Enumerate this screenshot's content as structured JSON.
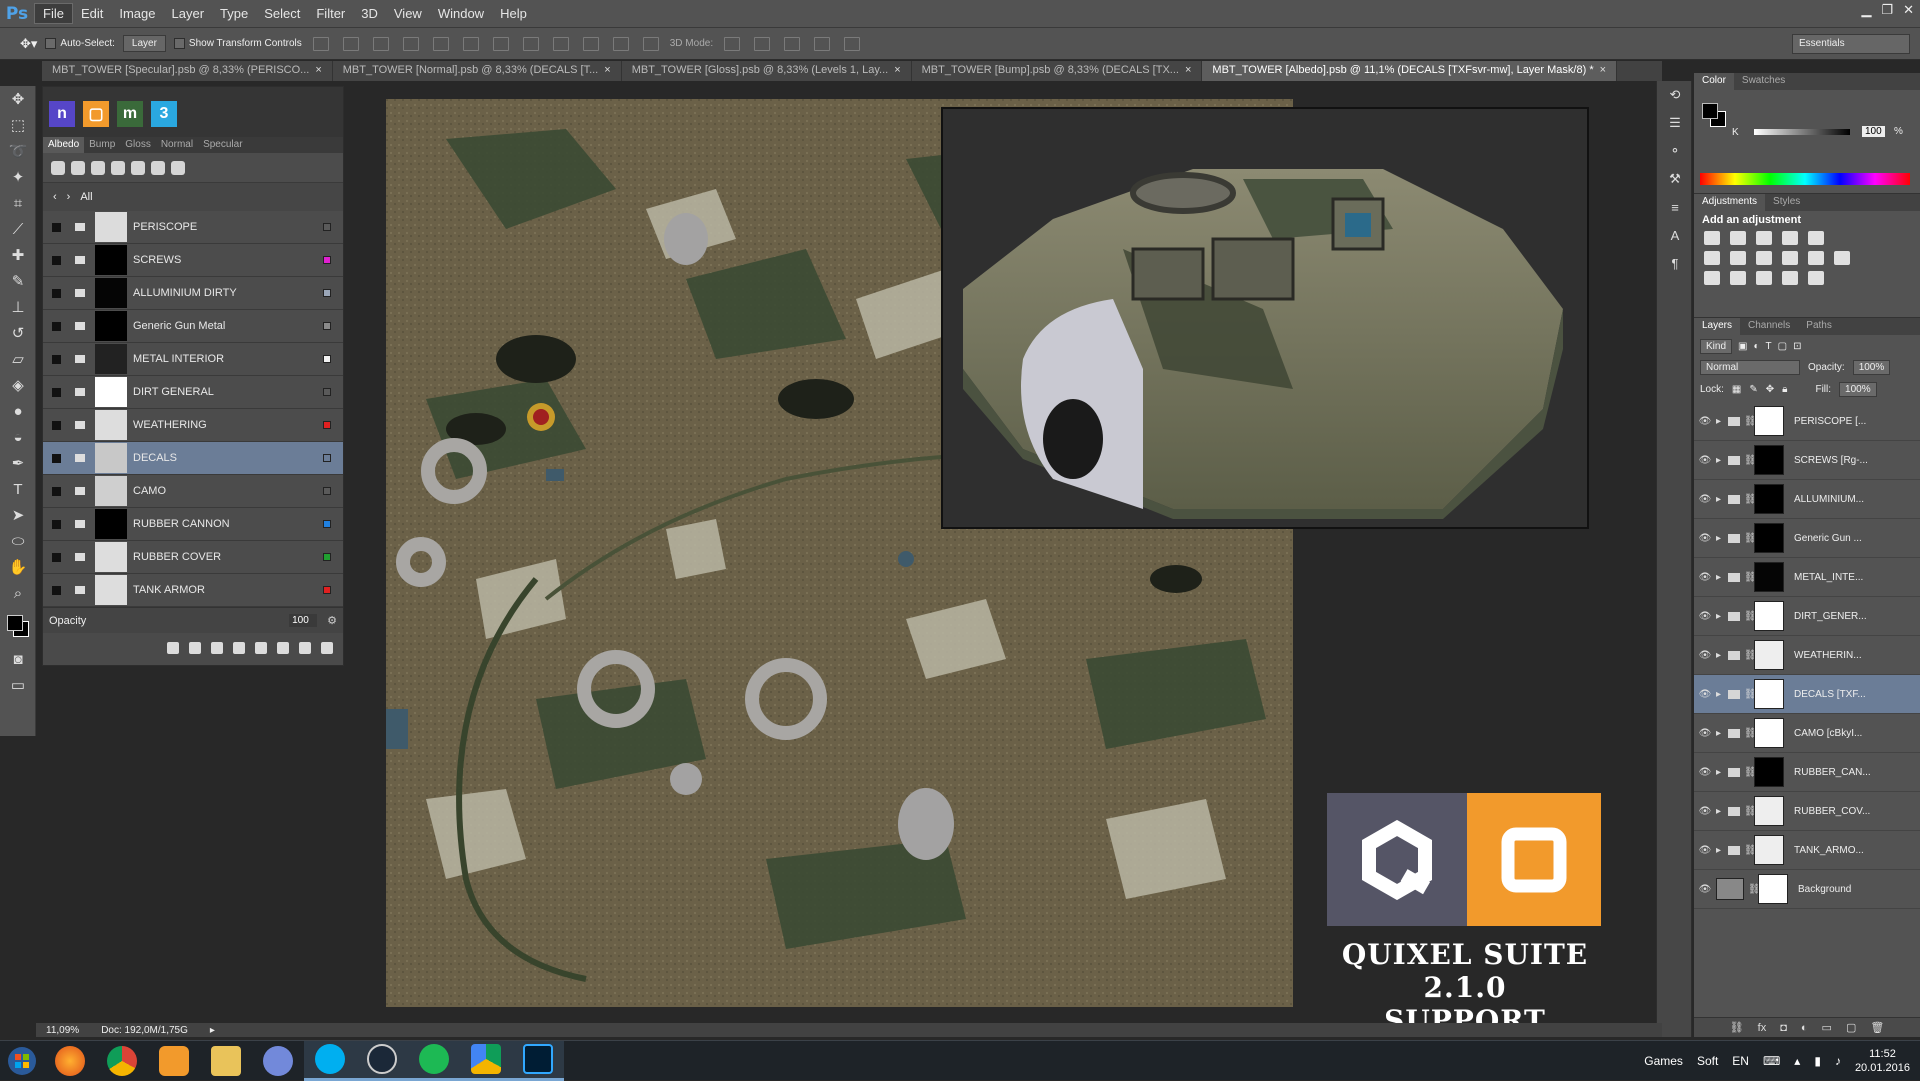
{
  "app": {
    "logo": "Ps"
  },
  "menu": [
    "File",
    "Edit",
    "Image",
    "Layer",
    "Type",
    "Select",
    "Filter",
    "3D",
    "View",
    "Window",
    "Help"
  ],
  "options": {
    "auto_select": "Auto-Select:",
    "layer_select": "Layer",
    "show_transform": "Show Transform Controls",
    "mode_3d": "3D Mode:",
    "workspace": "Essentials"
  },
  "tabs": [
    {
      "label": "MBT_TOWER [Specular].psb @ 8,33% (PERISCO...",
      "active": false
    },
    {
      "label": "MBT_TOWER [Normal].psb @ 8,33% (DECALS [T...",
      "active": false
    },
    {
      "label": "MBT_TOWER [Gloss].psb @ 8,33% (Levels 1, Lay...",
      "active": false
    },
    {
      "label": "MBT_TOWER [Bump].psb @ 8,33% (DECALS [TX...",
      "active": false
    },
    {
      "label": "MBT_TOWER [Albedo].psb @ 11,1% (DECALS [TXFsvr-mw], Layer Mask/8) *",
      "active": true
    }
  ],
  "ddo": {
    "tabs": [
      "Albedo",
      "Bump",
      "Gloss",
      "Normal",
      "Specular"
    ],
    "filter": "All",
    "layers": [
      {
        "name": "PERISCOPE",
        "thumb": "#dcdcdc",
        "swatch": "#5a5a5a",
        "selected": false
      },
      {
        "name": "SCREWS",
        "thumb": "#000000",
        "swatch": "#e020d0",
        "selected": false
      },
      {
        "name": "ALLUMINIUM DIRTY",
        "thumb": "#050505",
        "swatch": "#9aa6b8",
        "selected": false
      },
      {
        "name": "Generic Gun Metal",
        "thumb": "#000000",
        "swatch": "#8a8a8a",
        "selected": false
      },
      {
        "name": "METAL INTERIOR",
        "thumb": "#222222",
        "swatch": "#f2f2f2",
        "selected": false
      },
      {
        "name": "DIRT GENERAL",
        "thumb": "#ffffff",
        "swatch": "#5a5a5a",
        "selected": false
      },
      {
        "name": "WEATHERING",
        "thumb": "#dddddd",
        "swatch": "#e02020",
        "selected": false
      },
      {
        "name": "DECALS",
        "thumb": "#c8c8c8",
        "swatch": "#6b7d97",
        "selected": true
      },
      {
        "name": "CAMO",
        "thumb": "#cfcfcf",
        "swatch": "#5a5a5a",
        "selected": false
      },
      {
        "name": "RUBBER CANNON",
        "thumb": "#000000",
        "swatch": "#2080e0",
        "selected": false
      },
      {
        "name": "RUBBER COVER",
        "thumb": "#dddddd",
        "swatch": "#20a030",
        "selected": false
      },
      {
        "name": "TANK ARMOR",
        "thumb": "#dddddd",
        "swatch": "#e02020",
        "selected": false
      }
    ],
    "opacity_label": "Opacity",
    "opacity_value": "100"
  },
  "overlay_text": {
    "line1": "QUIXEL SUITE 2.1.0",
    "line2": "SUPPORT"
  },
  "color_panel": {
    "tabs": [
      "Color",
      "Swatches"
    ],
    "channel": "K",
    "value": "100",
    "unit": "%"
  },
  "adjustments": {
    "tabs": [
      "Adjustments",
      "Styles"
    ],
    "title": "Add an adjustment"
  },
  "layers_panel": {
    "tabs": [
      "Layers",
      "Channels",
      "Paths"
    ],
    "kind": "Kind",
    "blend": "Normal",
    "opacity_label": "Opacity:",
    "opacity": "100%",
    "lock_label": "Lock:",
    "fill_label": "Fill:",
    "fill": "100%",
    "layers": [
      {
        "name": "PERISCOPE [...",
        "mask": "#ffffff",
        "selected": false
      },
      {
        "name": "SCREWS [Rg-...",
        "mask": "#000000",
        "selected": false
      },
      {
        "name": "ALLUMINIUM...",
        "mask": "#000000",
        "selected": false
      },
      {
        "name": "Generic Gun ...",
        "mask": "#000000",
        "selected": false
      },
      {
        "name": "METAL_INTE...",
        "mask": "#050505",
        "selected": false
      },
      {
        "name": "DIRT_GENER...",
        "mask": "#ffffff",
        "selected": false
      },
      {
        "name": "WEATHERIN...",
        "mask": "#eeeeee",
        "selected": false
      },
      {
        "name": "DECALS [TXF...",
        "mask": "#ffffff",
        "selected": true
      },
      {
        "name": "CAMO [cBkyI...",
        "mask": "#ffffff",
        "selected": false
      },
      {
        "name": "RUBBER_CAN...",
        "mask": "#000000",
        "selected": false
      },
      {
        "name": "RUBBER_COV...",
        "mask": "#eeeeee",
        "selected": false
      },
      {
        "name": "TANK_ARMO...",
        "mask": "#eeeeee",
        "selected": false
      },
      {
        "name": "Background",
        "mask": "#ffffff",
        "selected": false
      }
    ]
  },
  "status": {
    "zoom": "11,09%",
    "doc": "Doc: 192,0M/1,75G"
  },
  "taskbar": {
    "apps": [
      "firefox-icon",
      "chrome-icon",
      "media-player-icon",
      "explorer-icon",
      "discord-icon",
      "skype-icon",
      "steam-icon",
      "spotify-icon",
      "google-drive-icon",
      "photoshop-icon"
    ],
    "tray_items": [
      "Games",
      "Soft",
      "EN"
    ],
    "time": "11:52",
    "date": "20.01.2016"
  }
}
